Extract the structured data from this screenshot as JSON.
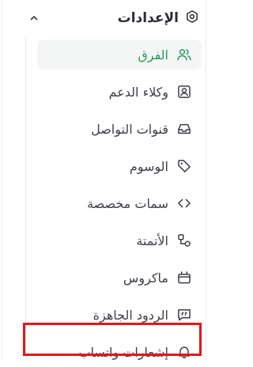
{
  "sidebar": {
    "section_title": "الإعدادات",
    "section_icon": "gear-icon",
    "collapse_icon": "chevron-up-icon",
    "items": [
      {
        "label": "الفرق",
        "icon": "users-icon",
        "active": true
      },
      {
        "label": "وكلاء الدعم",
        "icon": "contact-card-icon",
        "active": false
      },
      {
        "label": "قنوات التواصل",
        "icon": "inbox-icon",
        "active": false
      },
      {
        "label": "الوسوم",
        "icon": "tag-icon",
        "active": false
      },
      {
        "label": "سمات مخصصة",
        "icon": "code-icon",
        "active": false
      },
      {
        "label": "الأتمتة",
        "icon": "automation-icon",
        "active": false
      },
      {
        "label": "ماكروس",
        "icon": "macros-icon",
        "active": false
      },
      {
        "label": "الردود الجاهزة",
        "icon": "canned-reply-icon",
        "active": false
      },
      {
        "label": "إشعارات واتساب",
        "icon": "bell-icon",
        "active": false
      }
    ]
  },
  "colors": {
    "active_text": "#2a9b5e",
    "active_bg": "#f4f6f5",
    "highlight_border": "#e3161a"
  }
}
